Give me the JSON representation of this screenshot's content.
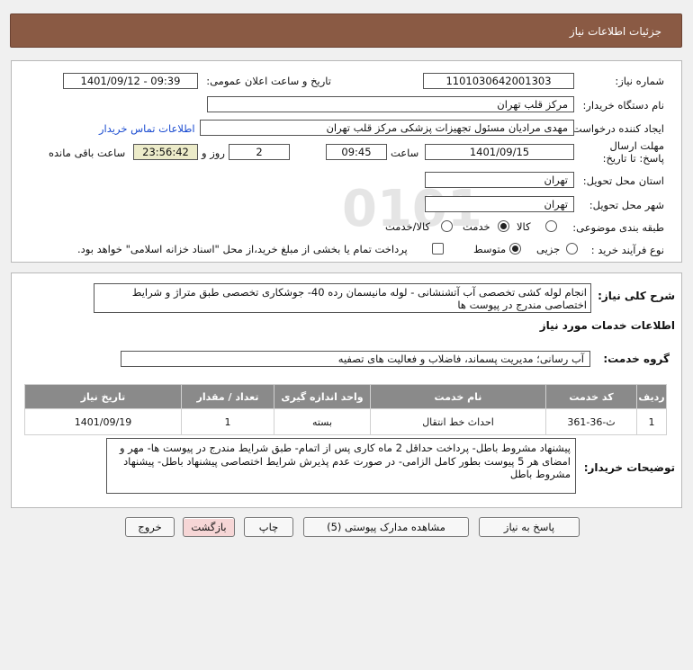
{
  "header_title": "جزئیات اطلاعات نیاز",
  "labels": {
    "need_number": "شماره نیاز:",
    "announce_datetime": "تاریخ و ساعت اعلان عمومی:",
    "buyer_org": "نام دستگاه خریدار:",
    "requester": "ایجاد کننده درخواست:",
    "contact_link": "اطلاعات تماس خریدار",
    "deadline": "مهلت ارسال پاسخ: تا تاریخ:",
    "time_word": "ساعت",
    "days_word": "روز و",
    "remaining": "ساعت باقی مانده",
    "province": "استان محل تحویل:",
    "city": "شهر محل تحویل:",
    "category": "طبقه بندی موضوعی:",
    "process_type": "نوع فرآیند خرید :"
  },
  "values": {
    "need_number": "1101030642001303",
    "announce_datetime": "1401/09/12 - 09:39",
    "buyer_org": "مرکز قلب تهران",
    "requester": "مهدی مرادیان مسئول تجهیزات پزشکی مرکز قلب تهران",
    "deadline_date": "1401/09/15",
    "deadline_time": "09:45",
    "days": "2",
    "remaining_time": "23:56:42",
    "province": "تهران",
    "city": "تهران"
  },
  "category_options": [
    {
      "label": "کالا",
      "selected": false
    },
    {
      "label": "خدمت",
      "selected": true
    },
    {
      "label": "کالا/خدمت",
      "selected": false
    }
  ],
  "process_options": [
    {
      "label": "جزیی",
      "selected": false
    },
    {
      "label": "متوسط",
      "selected": true
    }
  ],
  "payment_note": "پرداخت تمام یا بخشی از مبلغ خرید،از محل \"اسناد خزانه اسلامی\" خواهد بود.",
  "general_desc_label": "شرح کلی نیاز:",
  "general_desc": "انجام لوله کشی تخصصی آب آتشنشانی - لوله مانیسمان رده 40- جوشکاری تخصصی طبق متراژ و شرایط اختصاصی مندرج در پیوست ها",
  "services_info_title": "اطلاعات خدمات مورد نیاز",
  "service_group_label": "گروه خدمت:",
  "service_group": "آب رسانی؛ مدیریت پسماند، فاضلاب و فعالیت های تصفیه",
  "table": {
    "headers": [
      "ردیف",
      "کد خدمت",
      "نام خدمت",
      "واحد اندازه گیری",
      "تعداد / مقدار",
      "تاریخ نیاز"
    ],
    "rows": [
      [
        "1",
        "ث-36-361",
        "احداث خط انتقال",
        "بسته",
        "1",
        "1401/09/19"
      ]
    ]
  },
  "buyer_notes_label": "توضیحات خریدار:",
  "buyer_notes": "پیشنهاد مشروط باطل- پرداخت حداقل 2 ماه کاری پس از اتمام- طبق شرایط مندرج در پیوست ها- مهر و امضای هر 5 پیوست بطور کامل الزامی- در صورت عدم پذیرش شرایط اختصاصی پیشنهاد باطل- پیشنهاد مشروط باطل",
  "buttons": {
    "reply": "پاسخ به نیاز",
    "docs": "مشاهده مدارک پیوستی (5)",
    "print": "چاپ",
    "back": "بازگشت",
    "exit": "خروج"
  },
  "colors": {
    "header_bg": "#8a5a44",
    "table_header_bg": "#8a8a8a",
    "link": "#1a4bd0",
    "back_button_bg": "#f6d6d6"
  }
}
